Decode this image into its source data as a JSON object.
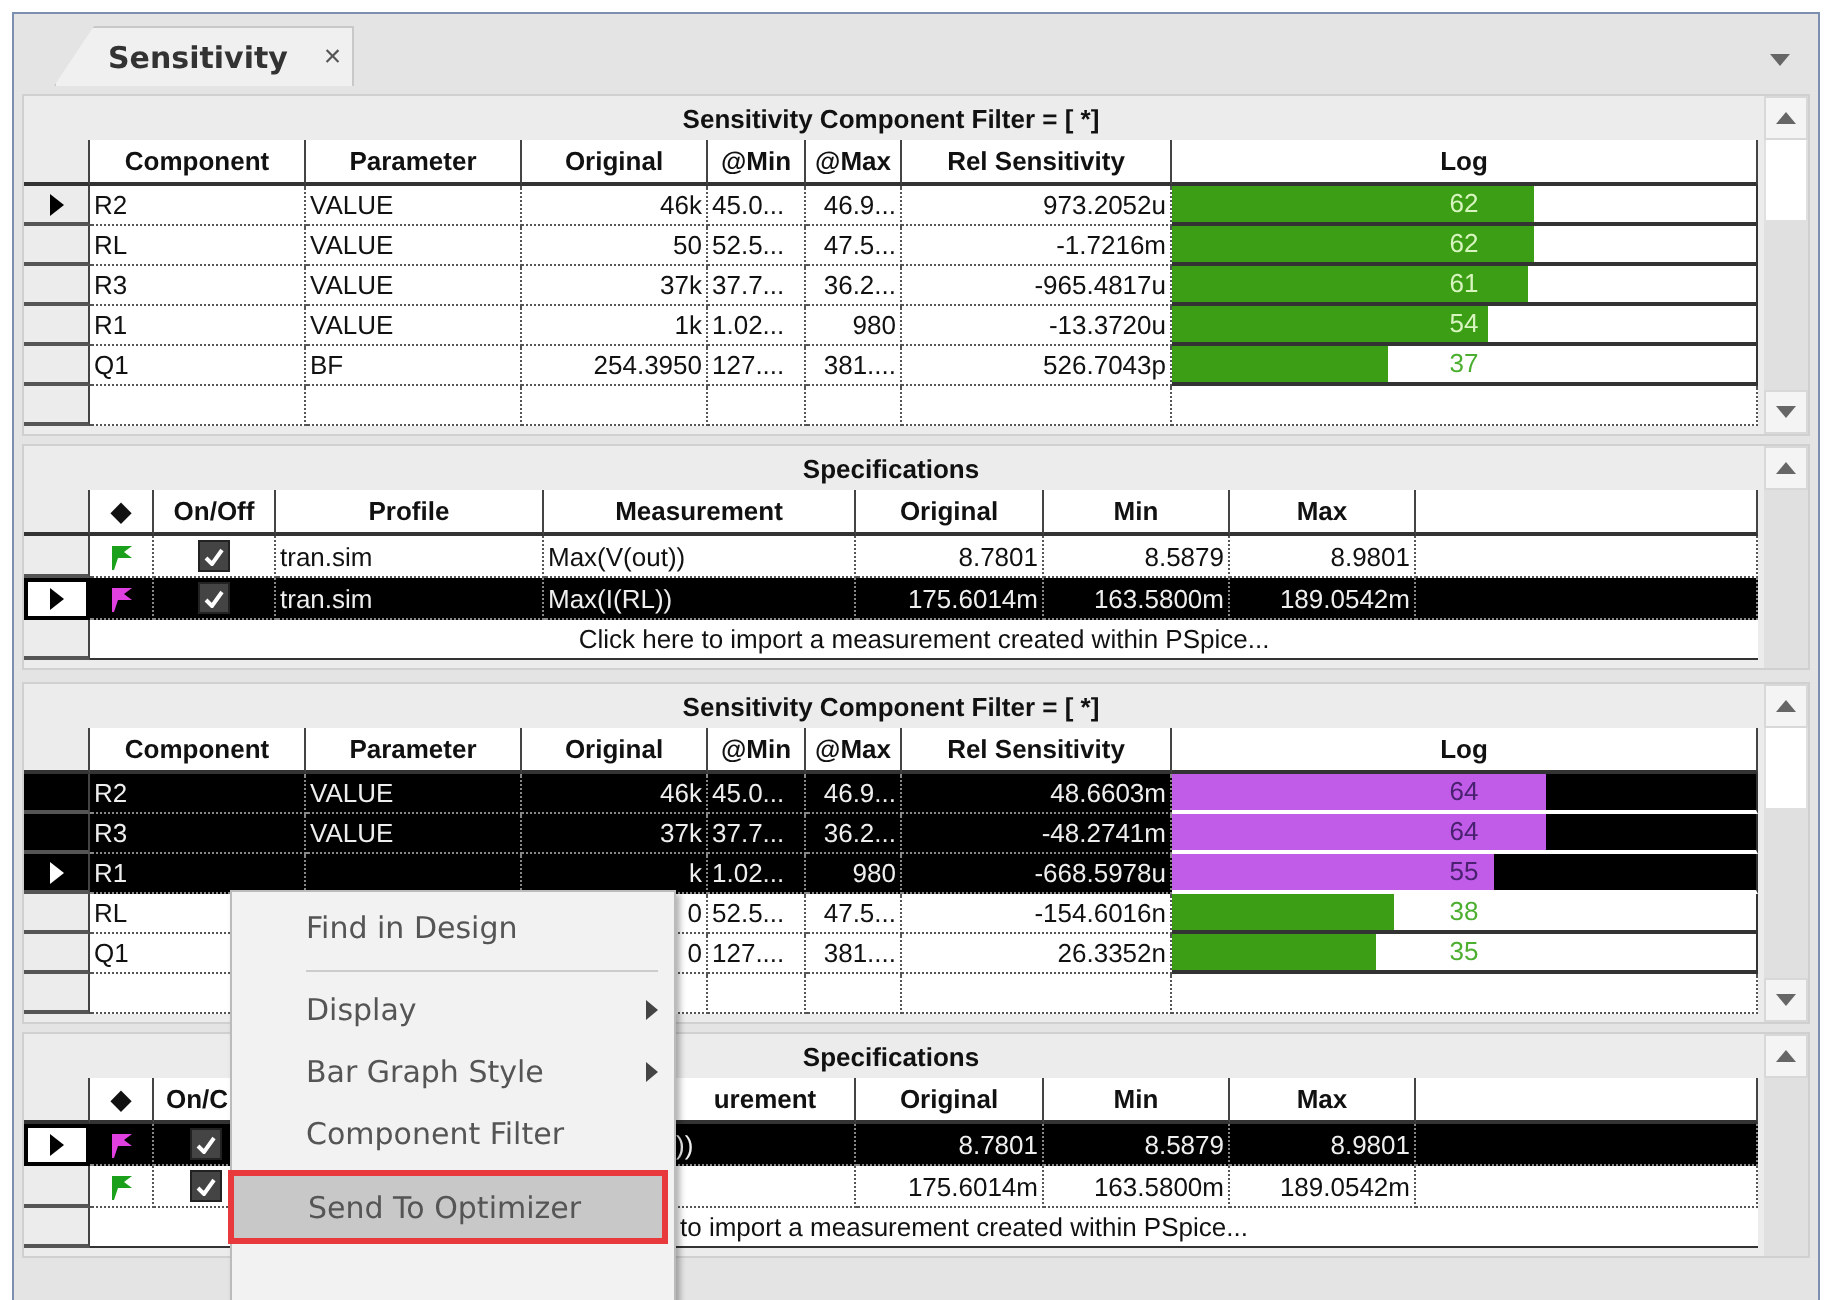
{
  "tab": {
    "title": "Sensitivity",
    "close": "×"
  },
  "views": [
    {
      "sensitivity": {
        "title": "Sensitivity Component Filter = [ *]",
        "columns": [
          "Component",
          "Parameter",
          "Original",
          "@Min",
          "@Max",
          "Rel Sensitivity",
          "Log"
        ],
        "rows": [
          {
            "component": "R2",
            "parameter": "VALUE",
            "original": "46k",
            "at_min": "45.0...",
            "at_max": "46.9...",
            "rel_sensitivity": "973.2052u",
            "log": "62",
            "level": 0.62,
            "selected": false,
            "current": true
          },
          {
            "component": "RL",
            "parameter": "VALUE",
            "original": "50",
            "at_min": "52.5...",
            "at_max": "47.5...",
            "rel_sensitivity": "-1.7216m",
            "log": "62",
            "level": 0.62,
            "selected": false,
            "current": false
          },
          {
            "component": "R3",
            "parameter": "VALUE",
            "original": "37k",
            "at_min": "37.7...",
            "at_max": "36.2...",
            "rel_sensitivity": "-965.4817u",
            "log": "61",
            "level": 0.61,
            "selected": false,
            "current": false
          },
          {
            "component": "R1",
            "parameter": "VALUE",
            "original": "1k",
            "at_min": "1.02...",
            "at_max": "980",
            "rel_sensitivity": "-13.3720u",
            "log": "54",
            "level": 0.54,
            "selected": false,
            "current": false
          },
          {
            "component": "Q1",
            "parameter": "BF",
            "original": "254.3950",
            "at_min": "127....",
            "at_max": "381....",
            "rel_sensitivity": "526.7043p",
            "log": "37",
            "level": 0.37,
            "selected": false,
            "current": false
          }
        ]
      },
      "specifications": {
        "title": "Specifications",
        "columns": [
          "◆",
          "On/Off",
          "Profile",
          "Measurement",
          "Original",
          "Min",
          "Max"
        ],
        "rows": [
          {
            "color": "#1aa01a",
            "on": true,
            "profile": "tran.sim",
            "measurement": "Max(V(out))",
            "original": "8.7801",
            "min": "8.5879",
            "max": "8.9801",
            "selected": false,
            "current": false
          },
          {
            "color": "#e040e0",
            "on": true,
            "profile": "tran.sim",
            "measurement": "Max(I(RL))",
            "original": "175.6014m",
            "min": "163.5800m",
            "max": "189.0542m",
            "selected": true,
            "current": true
          }
        ],
        "footer": "Click here to import a measurement created within PSpice..."
      }
    },
    {
      "sensitivity": {
        "title": "Sensitivity Component Filter = [ *]",
        "columns": [
          "Component",
          "Parameter",
          "Original",
          "@Min",
          "@Max",
          "Rel Sensitivity",
          "Log"
        ],
        "rows": [
          {
            "component": "R2",
            "parameter": "VALUE",
            "original": "46k",
            "at_min": "45.0...",
            "at_max": "46.9...",
            "rel_sensitivity": "48.6603m",
            "log": "64",
            "level": 0.64,
            "selected": true,
            "current": false
          },
          {
            "component": "R3",
            "parameter": "VALUE",
            "original": "37k",
            "at_min": "37.7...",
            "at_max": "36.2...",
            "rel_sensitivity": "-48.2741m",
            "log": "64",
            "level": 0.64,
            "selected": true,
            "current": false
          },
          {
            "component": "R1",
            "original": "k",
            "at_min": "1.02...",
            "at_max": "980",
            "rel_sensitivity": "-668.5978u",
            "log": "55",
            "level": 0.55,
            "selected": true,
            "current": true
          },
          {
            "component": "RL",
            "original": "0",
            "at_min": "52.5...",
            "at_max": "47.5...",
            "rel_sensitivity": "-154.6016n",
            "log": "38",
            "level": 0.38,
            "selected": false,
            "current": false
          },
          {
            "component": "Q1",
            "original": "0",
            "at_min": "127....",
            "at_max": "381....",
            "rel_sensitivity": "26.3352n",
            "log": "35",
            "level": 0.35,
            "selected": false,
            "current": false
          }
        ]
      },
      "specifications": {
        "title": "Specifications",
        "columns": [
          "◆",
          "On/C",
          "",
          "urement",
          "Original",
          "Min",
          "Max"
        ],
        "rows": [
          {
            "color": "#e040e0",
            "on": true,
            "measurement": "))",
            "original": "8.7801",
            "min": "8.5879",
            "max": "8.9801",
            "selected": true,
            "current": true
          },
          {
            "color": "#1aa01a",
            "on": true,
            "original": "175.6014m",
            "min": "163.5800m",
            "max": "189.0542m",
            "selected": false,
            "current": false
          }
        ],
        "footer": "to import a measurement created within PSpice..."
      },
      "context_menu": [
        {
          "kind": "item",
          "label": "Find in Design",
          "highlighted": false
        },
        {
          "kind": "separator"
        },
        {
          "kind": "submenu",
          "label": "Display",
          "highlighted": false
        },
        {
          "kind": "submenu",
          "label": "Bar Graph Style",
          "highlighted": false
        },
        {
          "kind": "item",
          "label": "Component Filter",
          "highlighted": false
        },
        {
          "kind": "item",
          "label": "Send To Optimizer",
          "highlighted": true
        }
      ]
    }
  ]
}
